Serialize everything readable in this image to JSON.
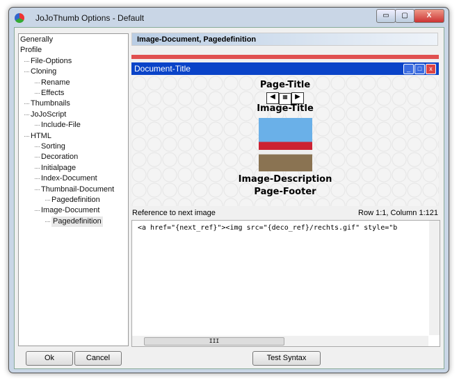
{
  "window": {
    "title": "JoJoThumb Options - Default",
    "minimize": "▭",
    "maximize": "▢",
    "close": "X"
  },
  "tree": [
    {
      "label": "Generally",
      "level": 0
    },
    {
      "label": "Profile",
      "level": 0
    },
    {
      "label": "File-Options",
      "level": 1
    },
    {
      "label": "Cloning",
      "level": 1
    },
    {
      "label": "Rename",
      "level": 2
    },
    {
      "label": "Effects",
      "level": 2
    },
    {
      "label": "Thumbnails",
      "level": 1
    },
    {
      "label": "JoJoScript",
      "level": 1
    },
    {
      "label": "Include-File",
      "level": 2
    },
    {
      "label": "HTML",
      "level": 1
    },
    {
      "label": "Sorting",
      "level": 2
    },
    {
      "label": "Decoration",
      "level": 2
    },
    {
      "label": "Initialpage",
      "level": 2
    },
    {
      "label": "Index-Document",
      "level": 2
    },
    {
      "label": "Thumbnail-Document",
      "level": 2
    },
    {
      "label": "Pagedefinition",
      "level": 3
    },
    {
      "label": "Image-Document",
      "level": 2
    },
    {
      "label": "Pagedefinition",
      "level": 3,
      "selected": true
    }
  ],
  "header": "Image-Document, Pagedefinition",
  "preview": {
    "window_title": "Document-Title",
    "page_title": "Page-Title",
    "image_title": "Image-Title",
    "image_description": "Image-Description",
    "page_footer": "Page-Footer"
  },
  "editor": {
    "label": "Reference to next image",
    "position": "Row 1:1, Column 1:121",
    "code": "<a href=\"{next_ref}\"><img src=\"{deco_ref}/rechts.gif\" style=\"b",
    "hscroll_grip": "III"
  },
  "buttons": {
    "ok": "Ok",
    "cancel": "Cancel",
    "test": "Test Syntax"
  }
}
